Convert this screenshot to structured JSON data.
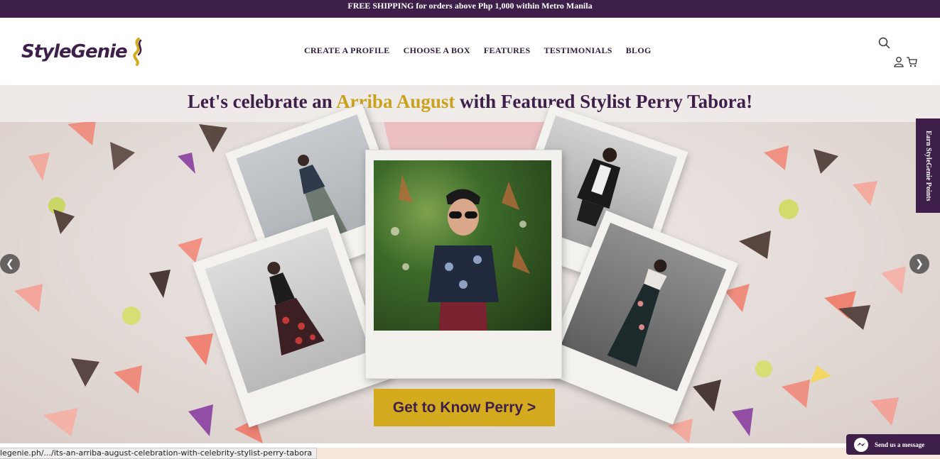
{
  "promo_bar": {
    "text": "FREE SHIPPING for orders above Php 1,000 within Metro Manila"
  },
  "header": {
    "logo_text": "StyleGenie",
    "nav": [
      "CREATE A PROFILE",
      "CHOOSE A BOX",
      "FEATURES",
      "TESTIMONIALS",
      "BLOG"
    ],
    "icons": [
      "search-icon",
      "user-icon",
      "cart-icon"
    ]
  },
  "hero": {
    "title_before": "Let's celebrate an ",
    "title_accent": "Arriba August",
    "title_after": " with Featured Stylist Perry Tabora!",
    "cta": "Get to Know Perry >",
    "prev_arrow": "❮",
    "next_arrow": "❯"
  },
  "side_tab": {
    "label": "Earn StyleGenie Points"
  },
  "messenger": {
    "label": "Send us a message"
  },
  "status_bar": {
    "url": "legenie.ph/.../its-an-arriba-august-celebration-with-celebrity-stylist-perry-tabora"
  },
  "colors": {
    "brand_purple": "#3d1f4a",
    "brand_gold": "#d4aa1e",
    "accent_gold": "#c9a21e"
  }
}
